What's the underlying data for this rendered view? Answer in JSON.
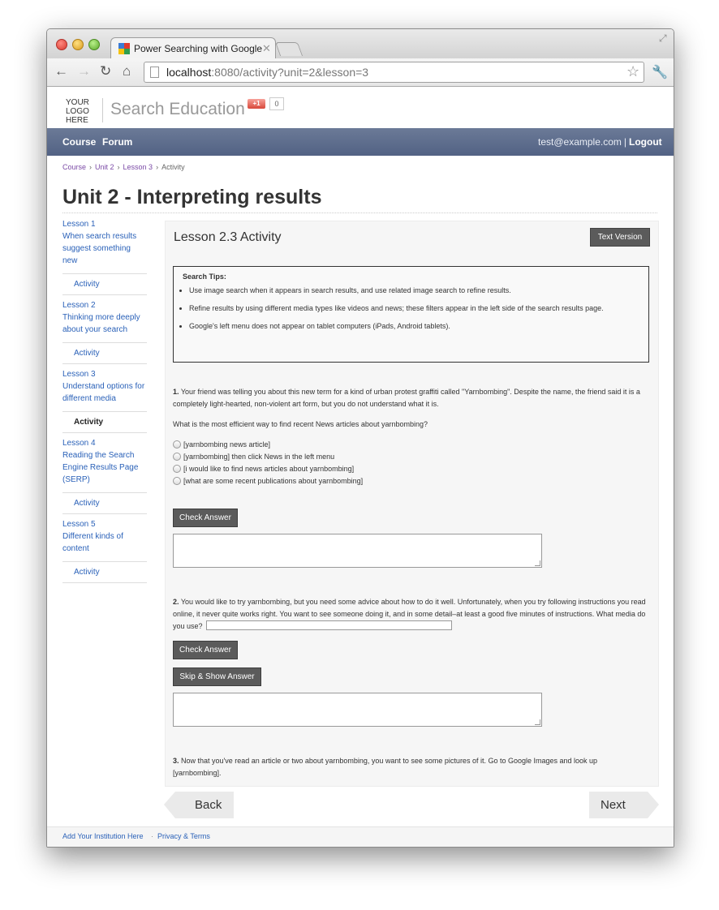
{
  "browser": {
    "tab_title": "Power Searching with Google",
    "tab_close": "✕",
    "url_host": "localhost",
    "url_rest": ":8080/activity?unit=2&lesson=3"
  },
  "header": {
    "logo_lines": [
      "YOUR",
      "LOGO",
      "HERE"
    ],
    "site_title": "Search Education",
    "gplus_label": "+1",
    "gplus_count": "0"
  },
  "nav": {
    "course": "Course",
    "forum": "Forum",
    "user_email": "test@example.com",
    "separator": "|",
    "logout": "Logout"
  },
  "breadcrumb": {
    "items": [
      "Course",
      "Unit 2",
      "Lesson 3",
      "Activity"
    ],
    "separator": "›"
  },
  "page_title": "Unit 2 - Interpreting results",
  "sidebar": {
    "lessons": [
      {
        "title": "Lesson 1",
        "subtitle": "When search results suggest something new",
        "activity": "Activity"
      },
      {
        "title": "Lesson 2",
        "subtitle": "Thinking more deeply about your search",
        "activity": "Activity"
      },
      {
        "title": "Lesson 3",
        "subtitle": "Understand options for different media",
        "activity": "Activity"
      },
      {
        "title": "Lesson 4",
        "subtitle": "Reading the Search Engine Results Page (SERP)",
        "activity": "Activity"
      },
      {
        "title": "Lesson 5",
        "subtitle": "Different kinds of content",
        "activity": "Activity"
      }
    ]
  },
  "activity": {
    "title": "Lesson 2.3 Activity",
    "text_version": "Text Version",
    "tips_heading": "Search Tips:",
    "tips": [
      "Use image search when it appears in search results, and use related image search to refine results.",
      "Refine results by using different media types like videos and news; these filters appear in the left side of the search results page.",
      "Google's left menu does not appear on tablet computers (iPads, Android tablets)."
    ],
    "q1_num": "1.",
    "q1_text": "Your friend was telling you about this new term for a kind of urban protest graffiti called \"Yarnbombing\". Despite the name, the friend said it is a completely light-hearted, non-violent art form, but you do not understand what it is.",
    "q1_prompt": "What is the most efficient way to find recent News articles about yarnbombing?",
    "q1_options": [
      "[yarnbombing news article]",
      "[yarnbombing] then click News in the left menu",
      "[i would like to find news articles about yarnbombing]",
      "[what are some recent publications about yarnbombing]"
    ],
    "check_answer": "Check Answer",
    "q2_num": "2.",
    "q2_text": "You would like to try yarnbombing, but you need some advice about how to do it well. Unfortunately, when you try following instructions you read online, it never quite works right. You want to see someone doing it, and in some detail–at least a good five minutes of instructions. What media do you use?",
    "skip_show": "Skip & Show Answer",
    "q3_num": "3.",
    "q3_text": "Now that you've read an article or two about yarnbombing, you want to see some pictures of it. Go to Google Images and look up [yarnbombing]."
  },
  "pager": {
    "back": "Back",
    "next": "Next"
  },
  "footer": {
    "add_institution": "Add Your Institution Here",
    "dot": "·",
    "privacy": "Privacy & Terms"
  }
}
